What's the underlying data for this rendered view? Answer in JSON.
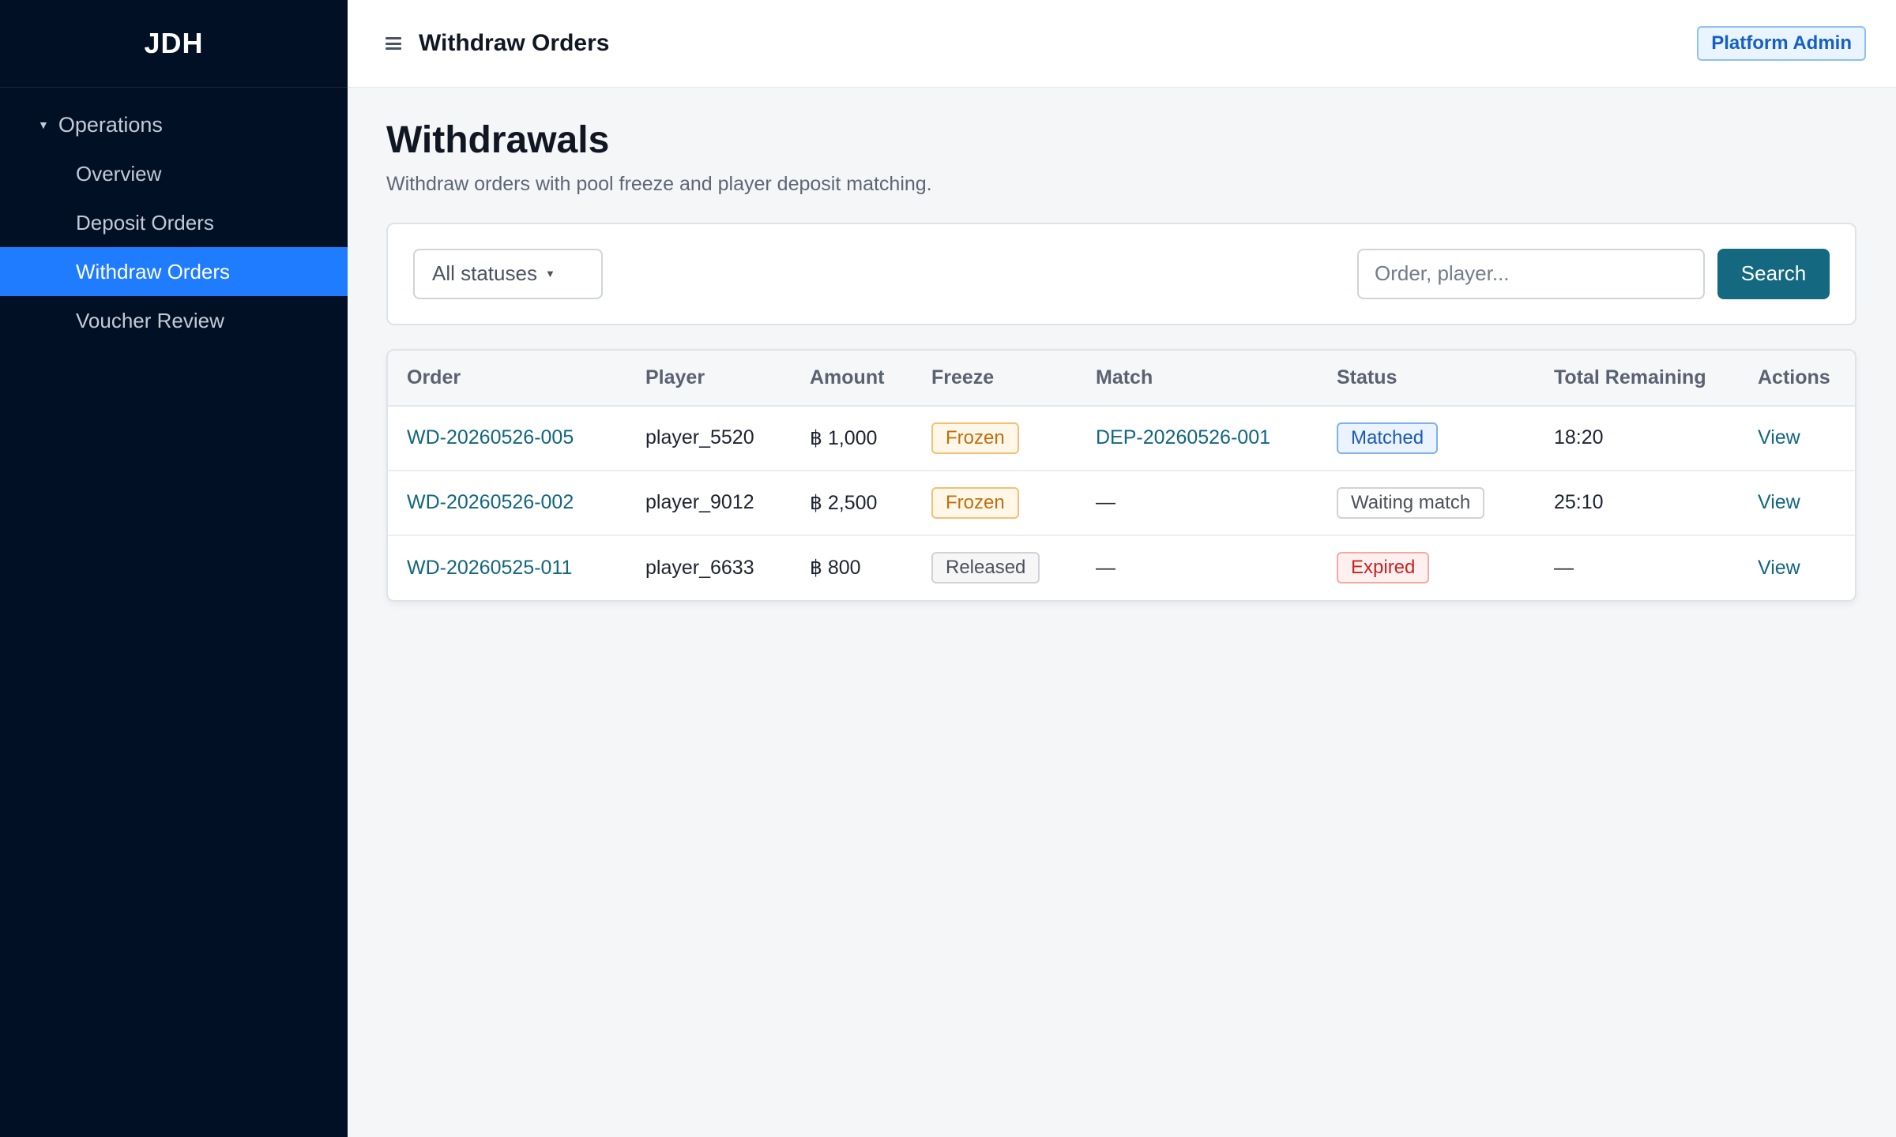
{
  "sidebar": {
    "brand": "JDH",
    "group_label": "Operations",
    "items": [
      {
        "label": "Overview",
        "active": false
      },
      {
        "label": "Deposit Orders",
        "active": false
      },
      {
        "label": "Withdraw Orders",
        "active": true
      },
      {
        "label": "Voucher Review",
        "active": false
      }
    ]
  },
  "topbar": {
    "title": "Withdraw Orders",
    "role_badge": "Platform Admin",
    "menu_icon": "hamburger-menu-icon"
  },
  "page": {
    "title": "Withdrawals",
    "subtitle": "Withdraw orders with pool freeze and player deposit matching."
  },
  "filters": {
    "status_select": "All statuses",
    "search_placeholder": "Order, player...",
    "search_button": "Search"
  },
  "table": {
    "columns": [
      "Order",
      "Player",
      "Amount",
      "Freeze",
      "Match",
      "Status",
      "Total Remaining",
      "Actions"
    ],
    "rows": [
      {
        "order": "WD-20260526-005",
        "player": "player_5520",
        "amount": "฿ 1,000",
        "freeze": "Frozen",
        "match": "DEP-20260526-001",
        "status": "Matched",
        "remaining": "18:20",
        "action": "View"
      },
      {
        "order": "WD-20260526-002",
        "player": "player_9012",
        "amount": "฿ 2,500",
        "freeze": "Frozen",
        "match": "—",
        "status": "Waiting match",
        "remaining": "25:10",
        "action": "View"
      },
      {
        "order": "WD-20260525-011",
        "player": "player_6633",
        "amount": "฿ 800",
        "freeze": "Released",
        "match": "—",
        "status": "Expired",
        "remaining": "—",
        "action": "View"
      }
    ]
  },
  "colors": {
    "sidebar_bg": "#021026",
    "active_nav": "#1f7cff",
    "primary_button": "#146981",
    "link": "#12667e"
  }
}
